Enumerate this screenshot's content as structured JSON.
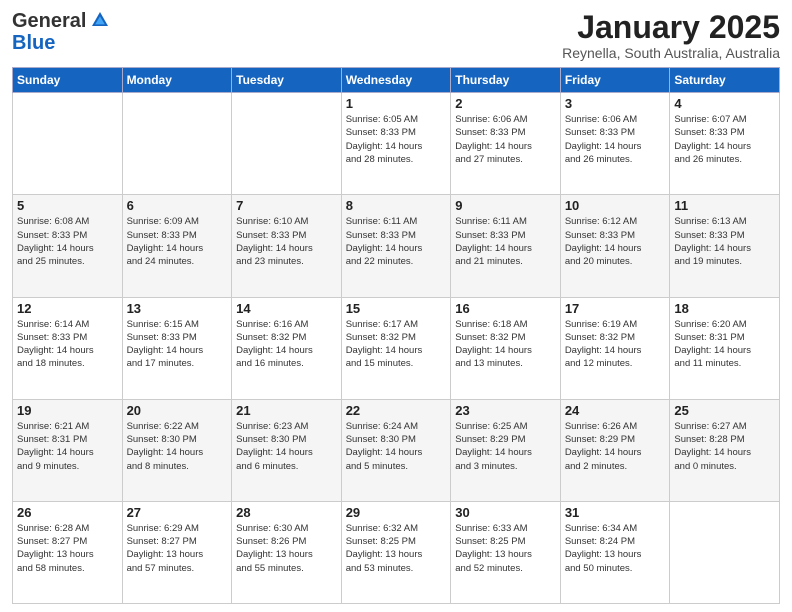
{
  "header": {
    "logo_general": "General",
    "logo_blue": "Blue",
    "month_title": "January 2025",
    "subtitle": "Reynella, South Australia, Australia"
  },
  "days_of_week": [
    "Sunday",
    "Monday",
    "Tuesday",
    "Wednesday",
    "Thursday",
    "Friday",
    "Saturday"
  ],
  "weeks": [
    [
      {
        "day": "",
        "info": ""
      },
      {
        "day": "",
        "info": ""
      },
      {
        "day": "",
        "info": ""
      },
      {
        "day": "1",
        "info": "Sunrise: 6:05 AM\nSunset: 8:33 PM\nDaylight: 14 hours\nand 28 minutes."
      },
      {
        "day": "2",
        "info": "Sunrise: 6:06 AM\nSunset: 8:33 PM\nDaylight: 14 hours\nand 27 minutes."
      },
      {
        "day": "3",
        "info": "Sunrise: 6:06 AM\nSunset: 8:33 PM\nDaylight: 14 hours\nand 26 minutes."
      },
      {
        "day": "4",
        "info": "Sunrise: 6:07 AM\nSunset: 8:33 PM\nDaylight: 14 hours\nand 26 minutes."
      }
    ],
    [
      {
        "day": "5",
        "info": "Sunrise: 6:08 AM\nSunset: 8:33 PM\nDaylight: 14 hours\nand 25 minutes."
      },
      {
        "day": "6",
        "info": "Sunrise: 6:09 AM\nSunset: 8:33 PM\nDaylight: 14 hours\nand 24 minutes."
      },
      {
        "day": "7",
        "info": "Sunrise: 6:10 AM\nSunset: 8:33 PM\nDaylight: 14 hours\nand 23 minutes."
      },
      {
        "day": "8",
        "info": "Sunrise: 6:11 AM\nSunset: 8:33 PM\nDaylight: 14 hours\nand 22 minutes."
      },
      {
        "day": "9",
        "info": "Sunrise: 6:11 AM\nSunset: 8:33 PM\nDaylight: 14 hours\nand 21 minutes."
      },
      {
        "day": "10",
        "info": "Sunrise: 6:12 AM\nSunset: 8:33 PM\nDaylight: 14 hours\nand 20 minutes."
      },
      {
        "day": "11",
        "info": "Sunrise: 6:13 AM\nSunset: 8:33 PM\nDaylight: 14 hours\nand 19 minutes."
      }
    ],
    [
      {
        "day": "12",
        "info": "Sunrise: 6:14 AM\nSunset: 8:33 PM\nDaylight: 14 hours\nand 18 minutes."
      },
      {
        "day": "13",
        "info": "Sunrise: 6:15 AM\nSunset: 8:33 PM\nDaylight: 14 hours\nand 17 minutes."
      },
      {
        "day": "14",
        "info": "Sunrise: 6:16 AM\nSunset: 8:32 PM\nDaylight: 14 hours\nand 16 minutes."
      },
      {
        "day": "15",
        "info": "Sunrise: 6:17 AM\nSunset: 8:32 PM\nDaylight: 14 hours\nand 15 minutes."
      },
      {
        "day": "16",
        "info": "Sunrise: 6:18 AM\nSunset: 8:32 PM\nDaylight: 14 hours\nand 13 minutes."
      },
      {
        "day": "17",
        "info": "Sunrise: 6:19 AM\nSunset: 8:32 PM\nDaylight: 14 hours\nand 12 minutes."
      },
      {
        "day": "18",
        "info": "Sunrise: 6:20 AM\nSunset: 8:31 PM\nDaylight: 14 hours\nand 11 minutes."
      }
    ],
    [
      {
        "day": "19",
        "info": "Sunrise: 6:21 AM\nSunset: 8:31 PM\nDaylight: 14 hours\nand 9 minutes."
      },
      {
        "day": "20",
        "info": "Sunrise: 6:22 AM\nSunset: 8:30 PM\nDaylight: 14 hours\nand 8 minutes."
      },
      {
        "day": "21",
        "info": "Sunrise: 6:23 AM\nSunset: 8:30 PM\nDaylight: 14 hours\nand 6 minutes."
      },
      {
        "day": "22",
        "info": "Sunrise: 6:24 AM\nSunset: 8:30 PM\nDaylight: 14 hours\nand 5 minutes."
      },
      {
        "day": "23",
        "info": "Sunrise: 6:25 AM\nSunset: 8:29 PM\nDaylight: 14 hours\nand 3 minutes."
      },
      {
        "day": "24",
        "info": "Sunrise: 6:26 AM\nSunset: 8:29 PM\nDaylight: 14 hours\nand 2 minutes."
      },
      {
        "day": "25",
        "info": "Sunrise: 6:27 AM\nSunset: 8:28 PM\nDaylight: 14 hours\nand 0 minutes."
      }
    ],
    [
      {
        "day": "26",
        "info": "Sunrise: 6:28 AM\nSunset: 8:27 PM\nDaylight: 13 hours\nand 58 minutes."
      },
      {
        "day": "27",
        "info": "Sunrise: 6:29 AM\nSunset: 8:27 PM\nDaylight: 13 hours\nand 57 minutes."
      },
      {
        "day": "28",
        "info": "Sunrise: 6:30 AM\nSunset: 8:26 PM\nDaylight: 13 hours\nand 55 minutes."
      },
      {
        "day": "29",
        "info": "Sunrise: 6:32 AM\nSunset: 8:25 PM\nDaylight: 13 hours\nand 53 minutes."
      },
      {
        "day": "30",
        "info": "Sunrise: 6:33 AM\nSunset: 8:25 PM\nDaylight: 13 hours\nand 52 minutes."
      },
      {
        "day": "31",
        "info": "Sunrise: 6:34 AM\nSunset: 8:24 PM\nDaylight: 13 hours\nand 50 minutes."
      },
      {
        "day": "",
        "info": ""
      }
    ]
  ]
}
